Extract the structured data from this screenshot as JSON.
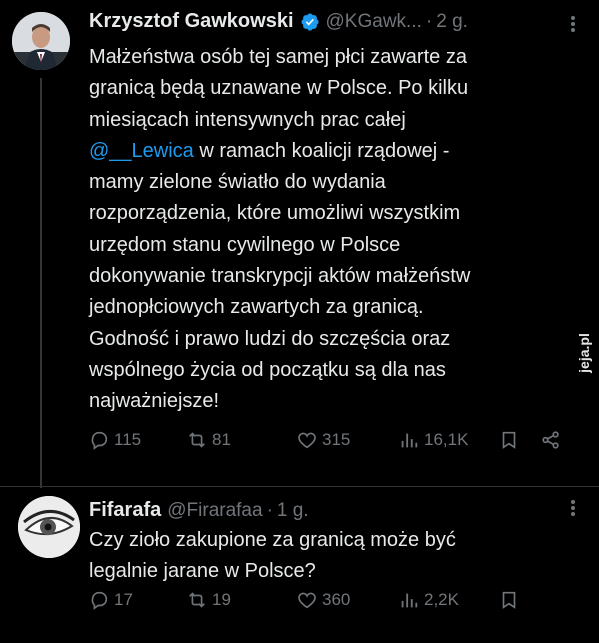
{
  "tweet1": {
    "name": "Krzysztof Gawkowski",
    "handle": "@KGawk...",
    "separator": "·",
    "time": "2 g.",
    "text_lines": [
      "Małżeństwa osób tej samej płci zawarte za",
      "granicą będą uznawane w Polsce. Po kilku",
      "miesiącach intensywnych prac całej",
      "",
      "mamy zielone światło do wydania",
      "rozporządzenia, które umożliwi wszystkim",
      "urzędom stanu cywilnego w Polsce",
      "dokonywanie transkrypcji aktów małżeństw",
      "jednopłciowych zawartych za granicą.",
      "Godność i prawo ludzi do szczęścia oraz",
      "wspólnego życia od początku są dla nas",
      "najważniejsze!"
    ],
    "mention": "@__Lewica",
    "line4_rest": " w ramach koalicji rządowej -",
    "replies": "115",
    "reposts": "81",
    "likes": "315",
    "views": "16,1K"
  },
  "tweet2": {
    "name": "Fifarafa",
    "handle": "@Firarafaa",
    "separator": "·",
    "time": "1 g.",
    "text_lines": [
      "Czy zioło zakupione za granicą może być",
      "legalnie jarane w Polsce?"
    ],
    "replies": "17",
    "reposts": "19",
    "likes": "360",
    "views": "2,2K"
  },
  "watermark": "jeja.pl",
  "colors": {
    "background": "#000000",
    "text": "#e7e9ea",
    "secondary": "#71767b",
    "accent": "#1d9bf0"
  }
}
